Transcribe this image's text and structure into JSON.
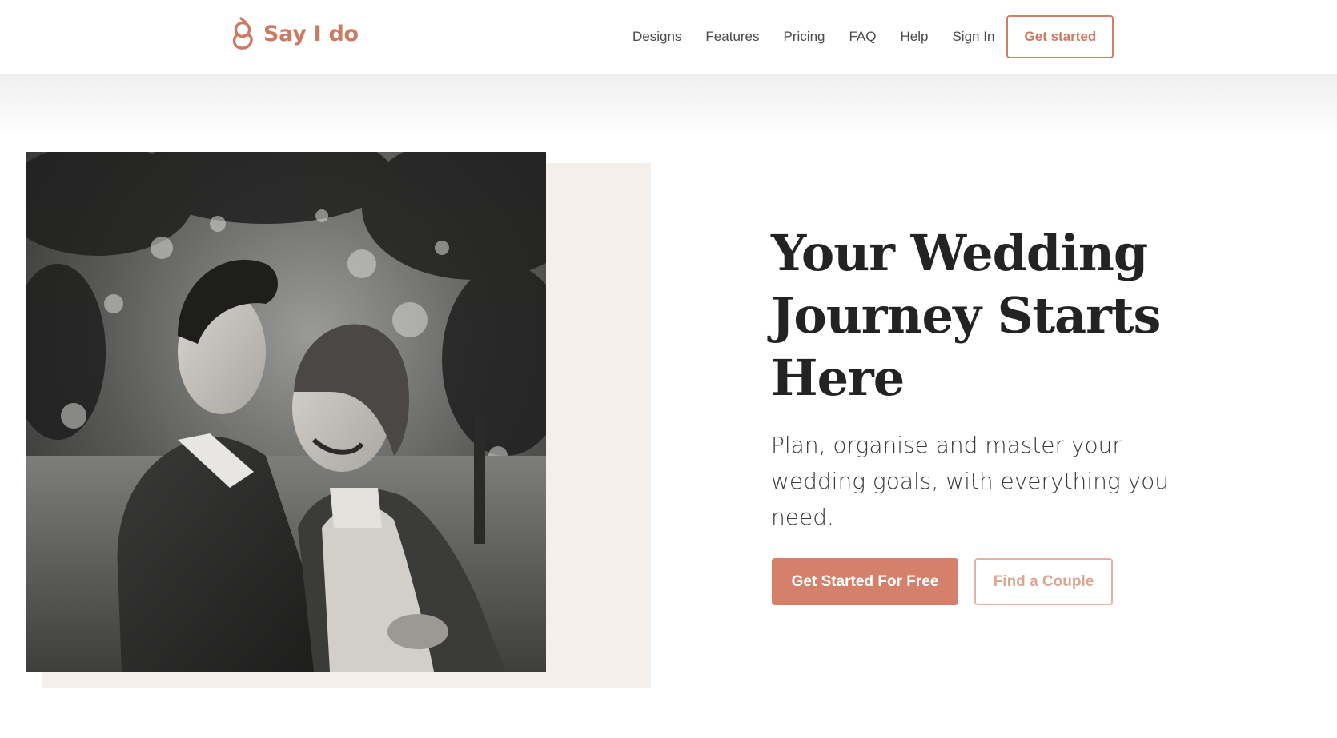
{
  "brand": {
    "name": "Say I do",
    "logo_icon": "interlinked-rings-icon",
    "accent_color": "#cc7a61"
  },
  "nav": {
    "items": [
      {
        "label": "Designs"
      },
      {
        "label": "Features"
      },
      {
        "label": "Pricing"
      },
      {
        "label": "FAQ"
      },
      {
        "label": "Help"
      },
      {
        "label": "Sign In"
      }
    ],
    "cta_label": "Get started"
  },
  "hero": {
    "photo_alt": "Black and white photo of a laughing bride and groom embracing under trees",
    "title": "Your Wedding Journey Starts Here",
    "subtitle": "Plan, organise and master your wedding goals, with everything you need.",
    "primary_cta": "Get Started For Free",
    "secondary_cta": "Find a Couple",
    "primary_color": "#d4806a",
    "panel_color": "#f4efea"
  }
}
